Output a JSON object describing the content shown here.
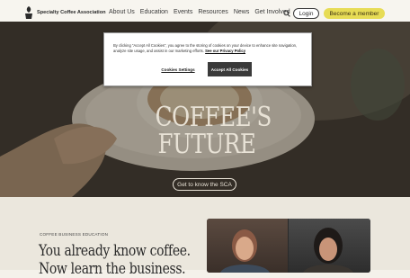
{
  "header": {
    "logo_text": "Specialty Coffee Association",
    "nav": [
      "About Us",
      "Education",
      "Events",
      "Resources",
      "News",
      "Get Involved"
    ],
    "login_label": "Login",
    "member_label": "Become a member"
  },
  "hero": {
    "title_line1": "COFFEE'S",
    "title_line2": "FUTURE",
    "cta_label": "Get to know the SCA"
  },
  "cookie_banner": {
    "text": "By clicking “Accept All Cookies”, you agree to the storing of cookies on your device to enhance site navigation, analyze site usage, and assist in our marketing efforts.",
    "privacy_link": "See our Privacy Policy",
    "settings_label": "Cookies Settings",
    "accept_label": "Accept All Cookies"
  },
  "section": {
    "label": "COFFEE BUSINESS EDUCATION",
    "heading_line1": "You already know coffee.",
    "heading_line2": "Now learn the business."
  },
  "colors": {
    "accent_yellow": "#e7dc55",
    "hero_dark": "#3b352c",
    "page_bg": "#f4f1ea"
  }
}
